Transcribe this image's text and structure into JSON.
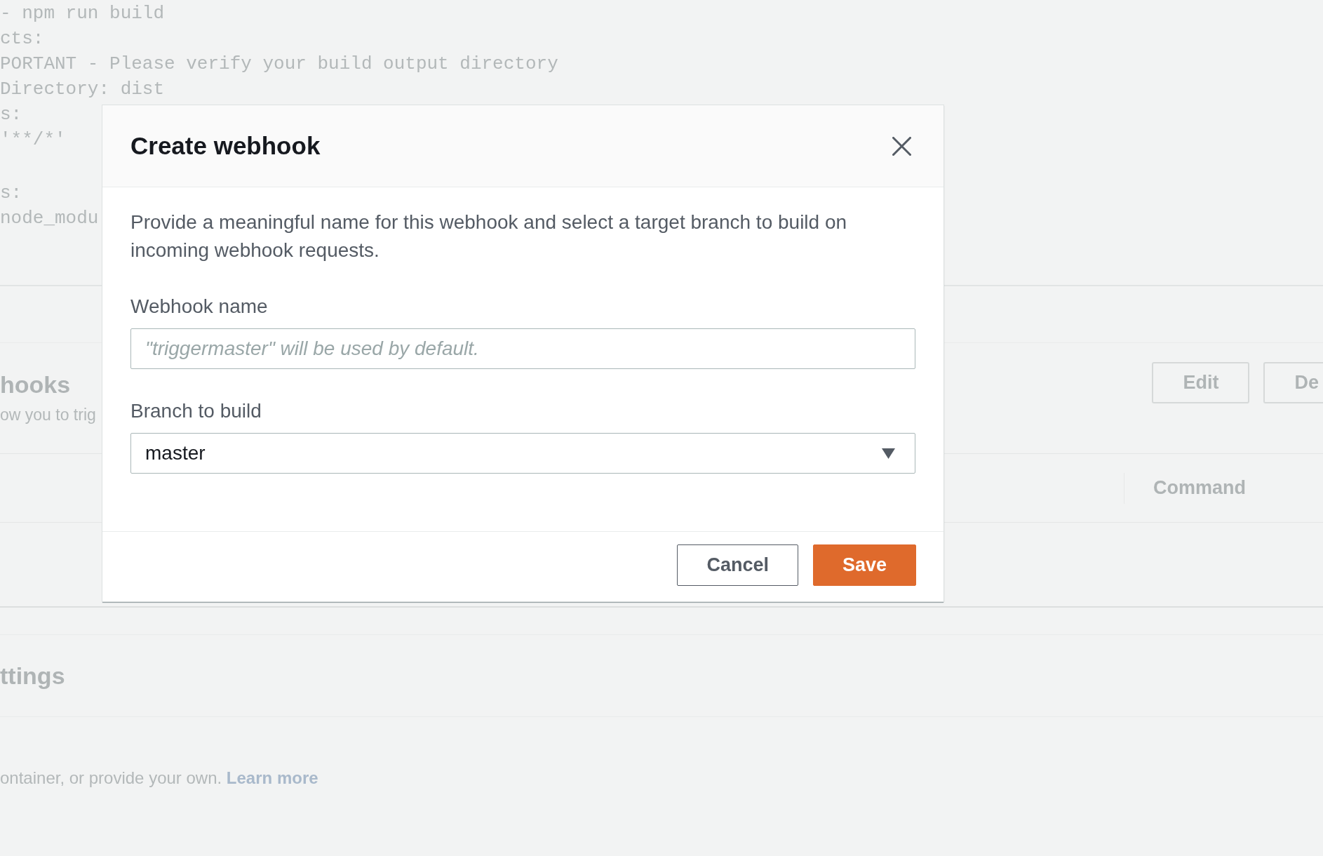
{
  "background": {
    "code_blocks": [
      [
        "- npm run build",
        "cts:",
        "PORTANT - Please verify your build output directory",
        "Directory: dist",
        "s:",
        "'**/*'"
      ],
      [
        "s:",
        "node_modu"
      ]
    ],
    "webhooks_section": {
      "title": "hooks",
      "description": "ow you to trig",
      "buttons": [
        "Edit",
        "De"
      ],
      "column_header": "Command"
    },
    "settings_section": {
      "title": "ttings",
      "description": "ontainer, or provide your own.",
      "link": "Learn more"
    }
  },
  "dialog": {
    "title": "Create webhook",
    "description": "Provide a meaningful name for this webhook and select a target branch to build on incoming webhook requests.",
    "fields": [
      {
        "kind": "text",
        "label": "Webhook name",
        "placeholder": "\"triggermaster\" will be used by default."
      },
      {
        "kind": "select",
        "label": "Branch to build",
        "value": "master"
      }
    ],
    "buttons": [
      {
        "kind": "secondary",
        "label": "Cancel"
      },
      {
        "kind": "primary",
        "label": "Save"
      }
    ]
  }
}
